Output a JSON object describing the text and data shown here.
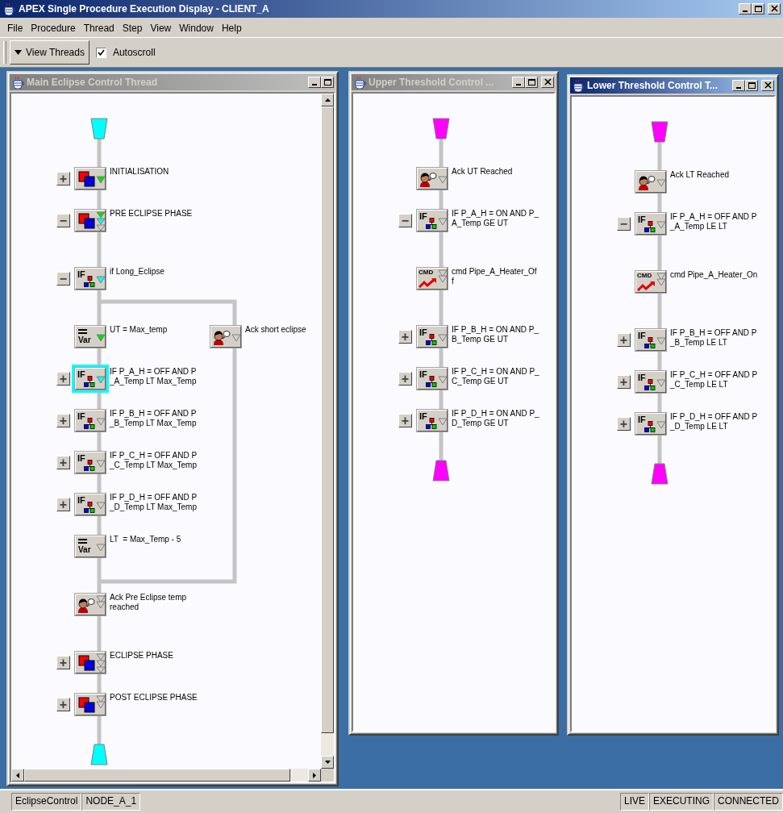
{
  "window": {
    "title": "APEX Single Procedure Execution Display - CLIENT_A"
  },
  "menu": [
    "File",
    "Procedure",
    "Thread",
    "Step",
    "View",
    "Window",
    "Help"
  ],
  "toolbar": {
    "view_threads": "View Threads",
    "autoscroll": {
      "label": "Autoscroll",
      "checked": true
    }
  },
  "threads": [
    {
      "title": "Main Eclipse Control Thread",
      "active": false,
      "closable": false,
      "scrollbars": true,
      "color": "#00ffff",
      "nodes": [
        {
          "kind": "phase",
          "lines": [
            "INITIALISATION"
          ],
          "toggle": "+",
          "markers": [
            {
              "color": "#00e000"
            }
          ],
          "selected": false
        },
        {
          "kind": "phase",
          "lines": [
            "PRE ECLIPSE PHASE"
          ],
          "toggle": "−",
          "markers": [
            {
              "color": "#00e000"
            },
            {
              "color": "#00ffff"
            },
            {
              "color": "#d4d0c8"
            }
          ],
          "selected": false,
          "children": [
            {
              "kind": "if",
              "tag": "IF",
              "lines": [
                "if Long_Eclipse"
              ],
              "toggle": "−",
              "markers": [
                {
                  "color": "#00ffff"
                }
              ],
              "selected": false,
              "branches": [
                [
                  {
                    "kind": "var",
                    "tag": "Var",
                    "lines": [
                      "UT = Max_temp"
                    ],
                    "markers": [
                      {
                        "color": "#00e000"
                      }
                    ],
                    "selected": false
                  },
                  {
                    "kind": "if",
                    "tag": "IF",
                    "lines": [
                      "IF P_A_H = OFF AND P",
                      "_A_Temp LT Max_Temp"
                    ],
                    "toggle": "+",
                    "markers": [
                      {
                        "color": "#00ffff"
                      }
                    ],
                    "selected": true
                  },
                  {
                    "kind": "if",
                    "tag": "IF",
                    "lines": [
                      "IF P_B_H = OFF AND P",
                      "_B_Temp LT Max_Temp"
                    ],
                    "toggle": "+",
                    "markers": [
                      {
                        "color": "#d4d0c8"
                      }
                    ],
                    "selected": false
                  },
                  {
                    "kind": "if",
                    "tag": "IF",
                    "lines": [
                      "IF P_C_H = OFF AND P",
                      "_C_Temp LT Max_Temp"
                    ],
                    "toggle": "+",
                    "markers": [
                      {
                        "color": "#d4d0c8"
                      }
                    ],
                    "selected": false
                  },
                  {
                    "kind": "if",
                    "tag": "IF",
                    "lines": [
                      "IF P_D_H = OFF AND P",
                      "_D_Temp LT Max_Temp"
                    ],
                    "toggle": "+",
                    "markers": [
                      {
                        "color": "#d4d0c8"
                      }
                    ],
                    "selected": false
                  },
                  {
                    "kind": "var",
                    "tag": "Var",
                    "lines": [
                      "LT  = Max_Temp - 5"
                    ],
                    "markers": [
                      {
                        "color": "#d4d0c8"
                      }
                    ],
                    "selected": false
                  }
                ],
                [
                  {
                    "kind": "ack",
                    "lines": [
                      "Ack short eclipse"
                    ],
                    "markers": [
                      {
                        "color": "#d4d0c8"
                      }
                    ],
                    "selected": false
                  }
                ]
              ]
            },
            {
              "kind": "ack",
              "lines": [
                "Ack Pre Eclipse temp",
                "reached"
              ],
              "markers": [
                {
                  "color": "#d4d0c8"
                },
                {
                  "color": "#d4d0c8"
                }
              ],
              "selected": false
            }
          ]
        },
        {
          "kind": "phase",
          "lines": [
            "ECLIPSE PHASE"
          ],
          "toggle": "+",
          "markers": [
            {
              "color": "#d4d0c8"
            },
            {
              "color": "#d4d0c8"
            },
            {
              "color": "#d4d0c8"
            }
          ],
          "selected": false
        },
        {
          "kind": "phase",
          "lines": [
            "POST ECLIPSE PHASE"
          ],
          "toggle": "+",
          "markers": [
            {
              "color": "#d4d0c8"
            },
            {
              "color": "#d4d0c8"
            }
          ],
          "selected": false
        }
      ]
    },
    {
      "title": "Upper Threshold Control ...",
      "active": false,
      "closable": true,
      "scrollbars": false,
      "color": "#ff00ff",
      "nodes": [
        {
          "kind": "ack",
          "lines": [
            "Ack UT Reached"
          ],
          "markers": [
            {
              "color": "#d4d0c8"
            }
          ],
          "selected": false
        },
        {
          "kind": "if",
          "tag": "IF",
          "lines": [
            "IF P_A_H = ON AND P_",
            "A_Temp GE UT"
          ],
          "toggle": "−",
          "markers": [
            {
              "color": "#d4d0c8"
            }
          ],
          "selected": false,
          "children": [
            {
              "kind": "cmd",
              "tag": "CMD",
              "lines": [
                "cmd Pipe_A_Heater_Of",
                "f"
              ],
              "markers": [
                {
                  "color": "#d4d0c8"
                },
                {
                  "color": "#d4d0c8"
                }
              ],
              "selected": false
            }
          ]
        },
        {
          "kind": "if",
          "tag": "IF",
          "lines": [
            "IF P_B_H = ON AND P_",
            "B_Temp GE UT"
          ],
          "toggle": "+",
          "markers": [
            {
              "color": "#d4d0c8"
            }
          ],
          "selected": false
        },
        {
          "kind": "if",
          "tag": "IF",
          "lines": [
            "IF P_C_H = ON AND P_",
            "C_Temp GE UT"
          ],
          "toggle": "+",
          "markers": [
            {
              "color": "#d4d0c8"
            }
          ],
          "selected": false
        },
        {
          "kind": "if",
          "tag": "IF",
          "lines": [
            "IF P_D_H = ON AND P_",
            "D_Temp GE UT"
          ],
          "toggle": "+",
          "markers": [
            {
              "color": "#d4d0c8"
            }
          ],
          "selected": false
        }
      ]
    },
    {
      "title": "Lower Threshold Control T...",
      "active": true,
      "closable": true,
      "scrollbars": false,
      "color": "#ff00ff",
      "nodes": [
        {
          "kind": "ack",
          "lines": [
            "Ack LT Reached"
          ],
          "markers": [
            {
              "color": "#d4d0c8"
            }
          ],
          "selected": false
        },
        {
          "kind": "if",
          "tag": "IF",
          "lines": [
            "IF P_A_H = OFF AND P",
            "_A_Temp LE LT"
          ],
          "toggle": "−",
          "markers": [
            {
              "color": "#d4d0c8"
            }
          ],
          "selected": false,
          "children": [
            {
              "kind": "cmd",
              "tag": "CMD",
              "lines": [
                "cmd Pipe_A_Heater_On"
              ],
              "markers": [
                {
                  "color": "#d4d0c8"
                },
                {
                  "color": "#d4d0c8"
                }
              ],
              "selected": false
            }
          ]
        },
        {
          "kind": "if",
          "tag": "IF",
          "lines": [
            "IF P_B_H = OFF AND P",
            "_B_Temp LE LT"
          ],
          "toggle": "+",
          "markers": [
            {
              "color": "#d4d0c8"
            }
          ],
          "selected": false
        },
        {
          "kind": "if",
          "tag": "IF",
          "lines": [
            "IF P_C_H = OFF AND P",
            "_C_Temp LE LT"
          ],
          "toggle": "+",
          "markers": [
            {
              "color": "#d4d0c8"
            }
          ],
          "selected": false
        },
        {
          "kind": "if",
          "tag": "IF",
          "lines": [
            "IF P_D_H = OFF AND P",
            "_D_Temp LE LT"
          ],
          "toggle": "+",
          "markers": [
            {
              "color": "#d4d0c8"
            }
          ],
          "selected": false
        }
      ]
    }
  ],
  "status_bar": {
    "left": [
      "EclipseControl",
      "NODE_A_1"
    ],
    "right": [
      "LIVE",
      "EXECUTING",
      "CONNECTED"
    ]
  }
}
